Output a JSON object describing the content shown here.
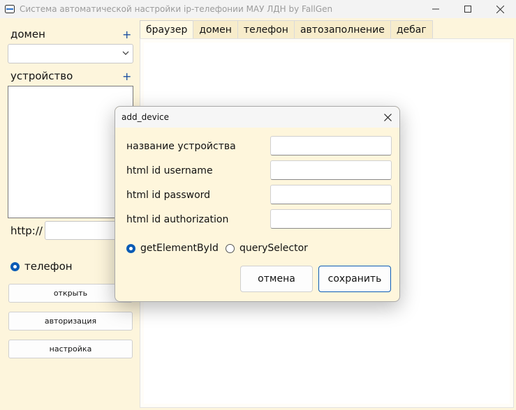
{
  "window": {
    "title": "Система автоматической настройки ip-телефонии МАУ ЛДН by FallGen"
  },
  "sidebar": {
    "domain_label": "домен",
    "domain_add": "+",
    "domain_selected": "",
    "device_label": "устройство",
    "device_add": "+",
    "url_prefix": "http://",
    "url_value": "",
    "radio_label": "телефон",
    "buttons": {
      "open": "открыть",
      "authorization": "авторизация",
      "settings": "настройка"
    }
  },
  "tabs": [
    "браузер",
    "домен",
    "телефон",
    "автозаполнение",
    "дебаг"
  ],
  "dialog": {
    "title": "add_device",
    "fields": [
      {
        "label": "название устройства",
        "value": ""
      },
      {
        "label": "html id username",
        "value": ""
      },
      {
        "label": "html id password",
        "value": ""
      },
      {
        "label": "html id authorization",
        "value": ""
      }
    ],
    "radio_options": [
      {
        "label": "getElementById",
        "selected": true
      },
      {
        "label": "querySelector",
        "selected": false
      }
    ],
    "cancel": "отмена",
    "save": "сохранить"
  },
  "colors": {
    "background": "#fdf5dc",
    "accent": "#0a5bb5",
    "plus": "#1a4fa0"
  }
}
